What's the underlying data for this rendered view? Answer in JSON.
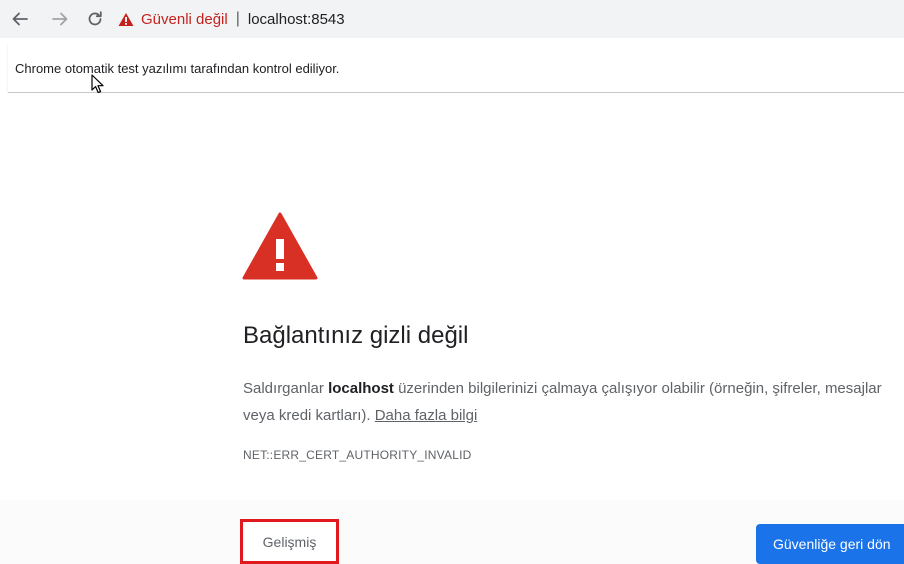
{
  "toolbar": {
    "back_icon": "arrow-left-icon",
    "forward_icon": "arrow-right-icon",
    "reload_icon": "reload-icon",
    "security_icon": "warning-triangle-icon",
    "security_label": "Güvenli değil",
    "separator": "|",
    "url": "localhost:8543"
  },
  "infobar": {
    "message": "Chrome otomatik test yazılımı tarafından kontrol ediliyor."
  },
  "interstitial": {
    "icon": "warning-triangle-icon",
    "heading": "Bağlantınız gizli değil",
    "explanation_before": "Saldırganlar ",
    "explanation_host": "localhost",
    "explanation_after": " üzerinden bilgilerinizi çalmaya çalışıyor olabilir (örneğin, şifreler, mesajlar veya kredi kartları). ",
    "learn_more": "Daha fazla bilgi",
    "error_code": "NET::ERR_CERT_AUTHORITY_INVALID",
    "advanced_button": "Gelişmiş",
    "back_to_safety_button": "Güvenliğe geri dön"
  },
  "colors": {
    "warning_red": "#d93025",
    "primary_button": "#1a73e8",
    "highlight_box": "#e0191f"
  }
}
